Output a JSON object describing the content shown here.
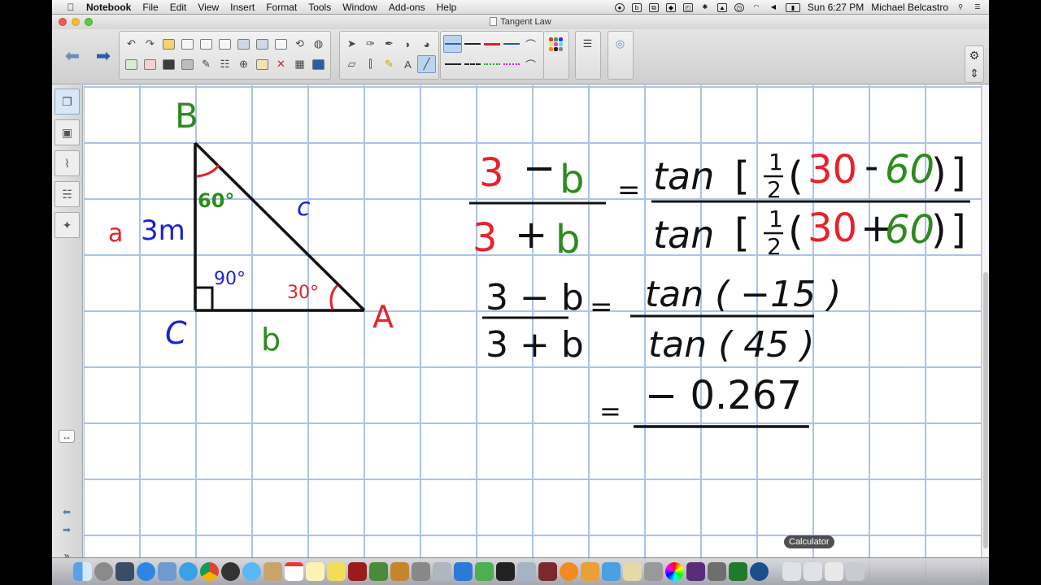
{
  "menubar": {
    "app_name": "Notebook",
    "menus": [
      "File",
      "Edit",
      "View",
      "Insert",
      "Format",
      "Tools",
      "Window",
      "Add-ons",
      "Help"
    ],
    "clock": "Sun 6:27 PM",
    "user": "Michael Belcastro"
  },
  "window": {
    "title": "Tangent Law"
  },
  "triangle": {
    "vertex_b": "B",
    "vertex_a": "A",
    "vertex_c": "C",
    "side_a_var": "a",
    "side_a_value": "3m",
    "side_c": "c",
    "side_b": "b",
    "angle_b": "60°",
    "angle_c": "90°",
    "angle_a": "30°"
  },
  "equations": {
    "line1_lhs_num_3": "3",
    "line1_lhs_num_op": "−",
    "line1_lhs_num_b": "b",
    "line1_lhs_den_3": "3",
    "line1_lhs_den_op": "+",
    "line1_lhs_den_b": "b",
    "equals": "=",
    "tan": "tan",
    "bracket_open": "[",
    "bracket_close": "]",
    "half_num": "1",
    "half_den": "2",
    "paren_open": "(",
    "paren_close": ")",
    "num_30": "30",
    "minus": "-",
    "num_60": "60",
    "plus": "+",
    "line2_lhs_num": "3 − b",
    "line2_lhs_den": "3 + b",
    "line2_rhs_num": "tan ( −15 )",
    "line2_rhs_den": "tan ( 45 )",
    "line3_result": "− 0.267"
  },
  "dock": {
    "tooltip": "Calculator"
  },
  "colors": {
    "red": "#e8212b",
    "green": "#2e8b1f",
    "blue": "#1a22d6",
    "grid": "#a9c3ea",
    "ink": "#111111"
  }
}
